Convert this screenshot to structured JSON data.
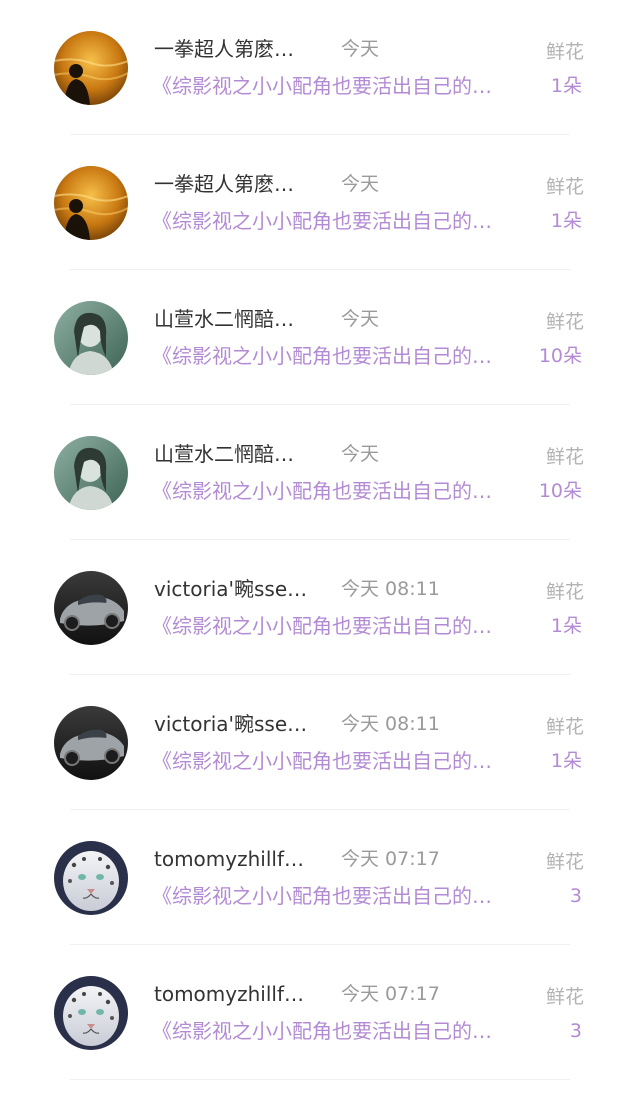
{
  "items": [
    {
      "avatar": "sunset-silhouette-avatar",
      "name": "一拳超人第麽…",
      "time": "今天",
      "gift_type": "鲜花",
      "book_title": "《综影视之小小配角也要活出自己的…",
      "count": "1朵"
    },
    {
      "avatar": "sunset-silhouette-avatar",
      "name": "一拳超人第麽…",
      "time": "今天",
      "gift_type": "鲜花",
      "book_title": "《综影视之小小配角也要活出自己的…",
      "count": "1朵"
    },
    {
      "avatar": "girl-portrait-avatar",
      "name": "山萱水二惘醅…",
      "time": "今天",
      "gift_type": "鲜花",
      "book_title": "《综影视之小小配角也要活出自己的…",
      "count": "10朵"
    },
    {
      "avatar": "girl-portrait-avatar",
      "name": "山萱水二惘醅…",
      "time": "今天",
      "gift_type": "鲜花",
      "book_title": "《综影视之小小配角也要活出自己的…",
      "count": "10朵"
    },
    {
      "avatar": "sports-car-avatar",
      "name": "victoria'畹sse…",
      "time": "今天 08:11",
      "gift_type": "鲜花",
      "book_title": "《综影视之小小配角也要活出自己的…",
      "count": "1朵"
    },
    {
      "avatar": "sports-car-avatar",
      "name": "victoria'畹sse…",
      "time": "今天 08:11",
      "gift_type": "鲜花",
      "book_title": "《综影视之小小配角也要活出自己的…",
      "count": "1朵"
    },
    {
      "avatar": "snow-leopard-avatar",
      "name": "tomomyzhillf…",
      "time": "今天 07:17",
      "gift_type": "鲜花",
      "book_title": "《综影视之小小配角也要活出自己的…",
      "count": "3"
    },
    {
      "avatar": "snow-leopard-avatar",
      "name": "tomomyzhillf…",
      "time": "今天 07:17",
      "gift_type": "鲜花",
      "book_title": "《综影视之小小配角也要活出自己的…",
      "count": "3"
    }
  ]
}
